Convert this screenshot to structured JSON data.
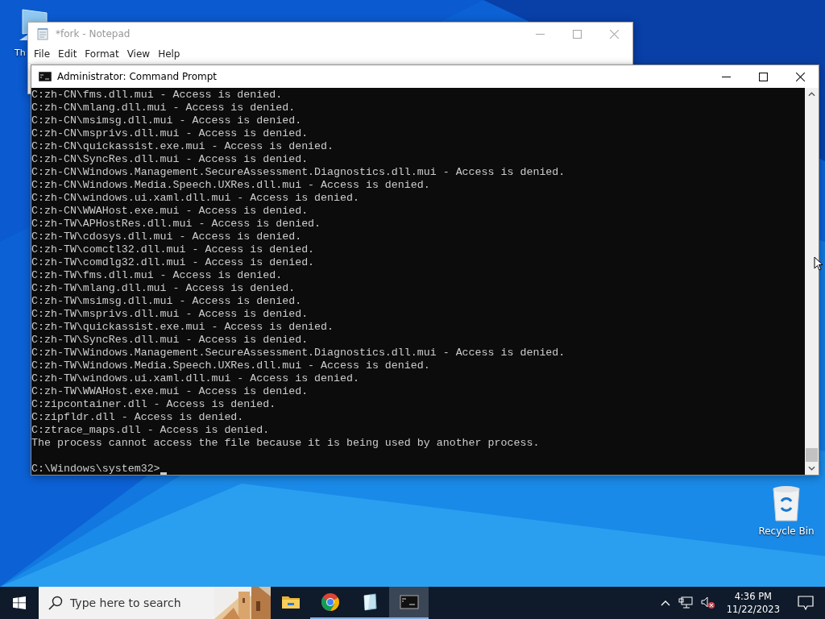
{
  "desktop_icons": [
    {
      "label": "Th"
    },
    {
      "label": "Recycle Bin"
    }
  ],
  "notepad": {
    "title": "*fork - Notepad",
    "menu": [
      "File",
      "Edit",
      "Format",
      "View",
      "Help"
    ]
  },
  "command_prompt": {
    "title": "Administrator: Command Prompt",
    "lines": [
      "C:zh-CN\\fms.dll.mui - Access is denied.",
      "C:zh-CN\\mlang.dll.mui - Access is denied.",
      "C:zh-CN\\msimsg.dll.mui - Access is denied.",
      "C:zh-CN\\msprivs.dll.mui - Access is denied.",
      "C:zh-CN\\quickassist.exe.mui - Access is denied.",
      "C:zh-CN\\SyncRes.dll.mui - Access is denied.",
      "C:zh-CN\\Windows.Management.SecureAssessment.Diagnostics.dll.mui - Access is denied.",
      "C:zh-CN\\Windows.Media.Speech.UXRes.dll.mui - Access is denied.",
      "C:zh-CN\\windows.ui.xaml.dll.mui - Access is denied.",
      "C:zh-CN\\WWAHost.exe.mui - Access is denied.",
      "C:zh-TW\\APHostRes.dll.mui - Access is denied.",
      "C:zh-TW\\cdosys.dll.mui - Access is denied.",
      "C:zh-TW\\comctl32.dll.mui - Access is denied.",
      "C:zh-TW\\comdlg32.dll.mui - Access is denied.",
      "C:zh-TW\\fms.dll.mui - Access is denied.",
      "C:zh-TW\\mlang.dll.mui - Access is denied.",
      "C:zh-TW\\msimsg.dll.mui - Access is denied.",
      "C:zh-TW\\msprivs.dll.mui - Access is denied.",
      "C:zh-TW\\quickassist.exe.mui - Access is denied.",
      "C:zh-TW\\SyncRes.dll.mui - Access is denied.",
      "C:zh-TW\\Windows.Management.SecureAssessment.Diagnostics.dll.mui - Access is denied.",
      "C:zh-TW\\Windows.Media.Speech.UXRes.dll.mui - Access is denied.",
      "C:zh-TW\\windows.ui.xaml.dll.mui - Access is denied.",
      "C:zh-TW\\WWAHost.exe.mui - Access is denied.",
      "C:zipcontainer.dll - Access is denied.",
      "C:zipfldr.dll - Access is denied.",
      "C:ztrace_maps.dll - Access is denied.",
      "The process cannot access the file because it is being used by another process."
    ],
    "prompt": "C:\\Windows\\system32>"
  },
  "taskbar": {
    "search": {
      "placeholder": "Type here to search"
    },
    "apps": [
      {
        "kind": "explorer",
        "running": false,
        "selected": false
      },
      {
        "kind": "chrome",
        "running": true,
        "selected": false
      },
      {
        "kind": "notepad",
        "running": true,
        "selected": false
      },
      {
        "kind": "console",
        "running": true,
        "selected": true
      }
    ],
    "time": "4:36 PM",
    "date": "11/22/2023"
  }
}
